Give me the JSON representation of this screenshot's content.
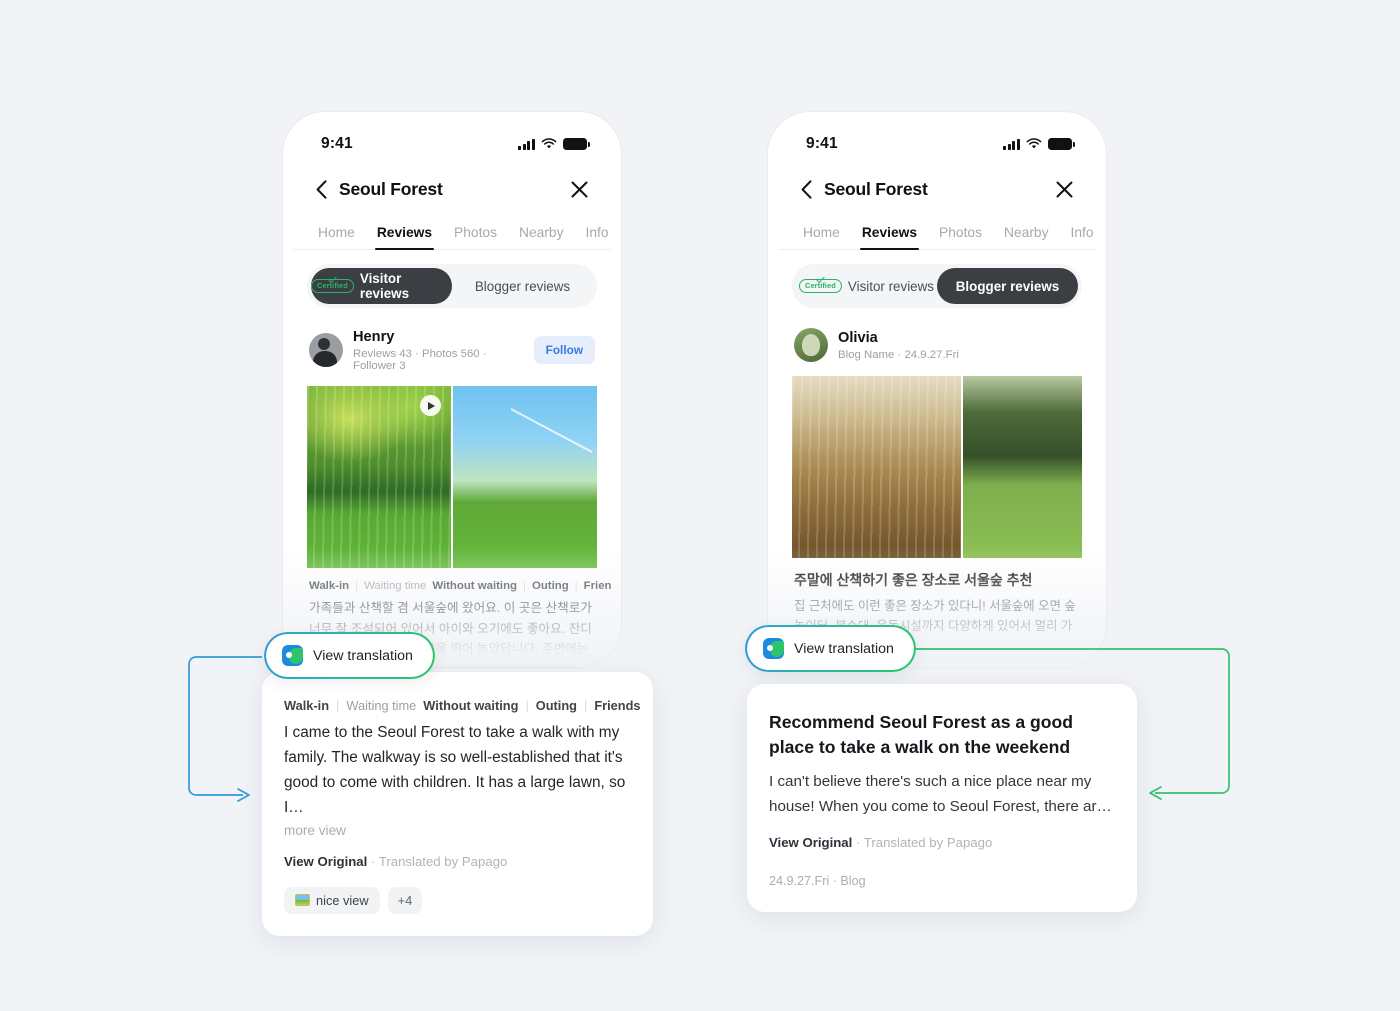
{
  "page": {
    "background": "#f1f3f6",
    "accent_blue": "#2f9bd8",
    "accent_green": "#2ec46d"
  },
  "phones": [
    {
      "id": "left",
      "status_bar": {
        "time": "9:41",
        "signal_icon": "signal-bars-icon",
        "wifi_icon": "wifi-icon",
        "battery_icon": "battery-icon"
      },
      "nav": {
        "back_icon": "chevron-left-icon",
        "title": "Seoul Forest",
        "close_icon": "close-icon"
      },
      "tabs": [
        {
          "label": "Home",
          "active": false
        },
        {
          "label": "Reviews",
          "active": true
        },
        {
          "label": "Photos",
          "active": false
        },
        {
          "label": "Nearby",
          "active": false
        },
        {
          "label": "Info",
          "active": false
        }
      ],
      "segmented": [
        {
          "label": "Visitor reviews",
          "badge": "Certified",
          "active": true
        },
        {
          "label": "Blogger reviews",
          "badge": null,
          "active": false
        }
      ],
      "author": {
        "name": "Henry",
        "meta": "Reviews 43 · Photos 560 · Follower 3",
        "follow_label": "Follow",
        "avatar": "avatar-henry"
      },
      "photos": [
        {
          "alt": "willow trees over pond with swans",
          "has_play_badge": true
        },
        {
          "alt": "park lawn with blue sky and contrail",
          "has_play_badge": false
        }
      ],
      "review_tags": [
        {
          "text": "Walk-in",
          "strong": true
        },
        {
          "text": "Waiting time",
          "strong": false
        },
        {
          "text": "Without waiting",
          "strong": true
        },
        {
          "text": "Outing",
          "strong": true
        },
        {
          "text": "Friends",
          "strong": true
        }
      ],
      "review_body_ko": "가족들과 산책할 겸 서울숲에 왔어요. 이 곳은 산책로가 너무 잘 조성되어 있어서 아이와 오기에도 좋아요. 잔디밭이 넓어서 아이와 한참을 뛰어 놀았답니다. 주변에는 맛집과 카페도 많아요. …"
    },
    {
      "id": "right",
      "status_bar": {
        "time": "9:41",
        "signal_icon": "signal-bars-icon",
        "wifi_icon": "wifi-icon",
        "battery_icon": "battery-icon"
      },
      "nav": {
        "back_icon": "chevron-left-icon",
        "title": "Seoul Forest",
        "close_icon": "close-icon"
      },
      "tabs": [
        {
          "label": "Home",
          "active": false
        },
        {
          "label": "Reviews",
          "active": true
        },
        {
          "label": "Photos",
          "active": false
        },
        {
          "label": "Nearby",
          "active": false
        },
        {
          "label": "Info",
          "active": false
        }
      ],
      "segmented": [
        {
          "label": "Visitor reviews",
          "badge": "Certified",
          "active": false
        },
        {
          "label": "Blogger reviews",
          "badge": null,
          "active": true
        }
      ],
      "author": {
        "name": "Olivia",
        "meta": "Blog Name · 24.9.27.Fri",
        "follow_label": null,
        "avatar": "avatar-olivia"
      },
      "photos": [
        {
          "alt": "grove of tall thin trees in autumn light",
          "has_play_badge": false
        },
        {
          "alt": "large tree on green lawn with visitors",
          "has_play_badge": false
        }
      ],
      "blog_title_ko": "주말에 산책하기 좋은 장소로 서울숲 추천",
      "blog_body_ko": "집 근처에도 이런 좋은 장소가 있다니! 서울숲에 오면 숲놀이터, 분수대, 운동시설까지 다양하게 있어서 멀리 가지 않아…"
    }
  ],
  "view_translation": {
    "label": "View translation",
    "icon": "papago-icon"
  },
  "translation_cards": {
    "left": {
      "tags": [
        {
          "text": "Walk-in",
          "strong": true
        },
        {
          "text": "Waiting time",
          "strong": false
        },
        {
          "text": "Without waiting",
          "strong": true
        },
        {
          "text": "Outing",
          "strong": true
        },
        {
          "text": "Friends",
          "strong": true
        }
      ],
      "body": "I came to the Seoul Forest to take a walk with my family. The walkway is so well-established that it's good to come with children. It has a large lawn, so I…",
      "more_label": "more view",
      "view_original_label": "View Original",
      "translated_by": "· Translated by Papago",
      "chips": [
        {
          "emoji": "framed-picture-emoji",
          "label": "nice view"
        },
        {
          "emoji": null,
          "label": "+4"
        }
      ]
    },
    "right": {
      "title": "Recommend Seoul Forest as a good place to take a walk on the weekend",
      "body": "I can't believe there's such a nice place near my house! When you come to Seoul Forest, there ar…",
      "view_original_label": "View Original",
      "translated_by": "· Translated by Papago",
      "date_meta": "24.9.27.Fri · Blog"
    }
  }
}
